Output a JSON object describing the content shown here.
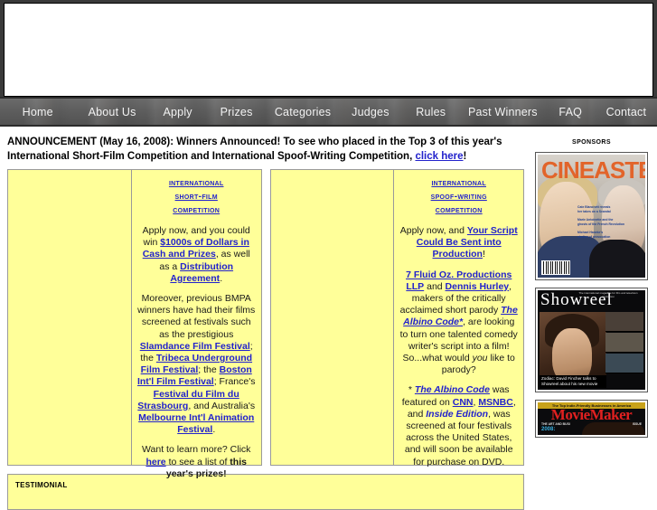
{
  "nav": {
    "items": [
      {
        "label": "Home"
      },
      {
        "label": "About Us"
      },
      {
        "label": "Apply"
      },
      {
        "label": "Prizes"
      },
      {
        "label": "Categories"
      },
      {
        "label": "Judges"
      },
      {
        "label": "Rules"
      },
      {
        "label": "Past Winners"
      },
      {
        "label": "FAQ"
      },
      {
        "label": "Contact"
      }
    ]
  },
  "announcement": {
    "line1": "ANNOUNCEMENT (May 16, 2008): Winners Announced! To see who placed in the Top 3 of this year's",
    "line2_pre": "International Short-Film Competition and International Spoof-Writing Competition, ",
    "link": "click here",
    "line2_post": "!"
  },
  "film_box": {
    "title_line1": "International",
    "title_line2": "Short-Film",
    "title_line3": "Competition",
    "p1_a": "Apply now, and you could win ",
    "p1_link1": "$1000s of Dollars in Cash and Prizes",
    "p1_b": ", as well as a ",
    "p1_link2": "Distribution Agreement",
    "p1_c": ".",
    "p2_a": "Moreover, previous BMPA winners have had their films screened at festivals such as the prestigious ",
    "p2_link1": "Slamdance Film Festival",
    "p2_b": "; the ",
    "p2_link2": "Tribeca Underground Film Festival",
    "p2_c": "; the ",
    "p2_link3": "Boston Int'l Film Festival",
    "p2_d": "; France's ",
    "p2_link4": "Festival du Film du Strasbourg",
    "p2_e": ", and Australia's ",
    "p2_link5": "Melbourne Int'l Animation Festival",
    "p2_f": ".",
    "p3_a": "Want to learn more? Click ",
    "p3_link": "here",
    "p3_b": " to see a list of ",
    "p3_bold": "this year's prizes!"
  },
  "spoof_box": {
    "title_line1": "International",
    "title_line2": "Spoof-Writing",
    "title_line3": "Competition",
    "p1_a": "Apply now, and ",
    "p1_link": "Your Script Could Be Sent into Production",
    "p1_b": "!",
    "p2_link1": "7 Fluid Oz. Productions LLP",
    "p2_a": " and ",
    "p2_link2": "Dennis Hurley",
    "p2_b": ", makers of the critically acclaimed short parody ",
    "p2_title": "The Albino Code*",
    "p2_c": ", are looking to turn one talented comedy writer's script into a film! So...what would ",
    "p2_you": "you",
    "p2_d": " like to parody?",
    "p3_star": "* ",
    "p3_title": "The Albino Code",
    "p3_a": " was featured on ",
    "p3_link1": "CNN",
    "p3_b": ", ",
    "p3_link2": "MSNBC",
    "p3_c": ", and ",
    "p3_em": "Inside Edition",
    "p3_d": ", was screened at four festivals across the United States, and will soon be available for purchase on DVD."
  },
  "testimonial": {
    "title": "Testimonial"
  },
  "sponsors": {
    "title": "Sponsors",
    "items": [
      {
        "name": "Cineaste",
        "wordmark": "CINEASTE",
        "blurbs": [
          "Cate Blanchett reveals",
          "her takes on a Scandal",
          "Marie Antoinette and the",
          "ghosts of the French Revolution",
          "Michael Haneke's",
          "studies of provocation"
        ]
      },
      {
        "name": "Showreel",
        "wordmark": "Showreel",
        "tagline": "The international magazine for film and television production",
        "caption": "Zodiac: David Fincher talks to Showreel about his new movie"
      },
      {
        "name": "MovieMaker",
        "wordmark": "MovieMaker",
        "topline": "The Top Indie-Friendly Businesses in America",
        "subleft": "THE ART AND BUSI",
        "subright": "ISSUE",
        "year": "2008:"
      }
    ]
  },
  "colors": {
    "panel_yellow": "#ffff99",
    "link_blue": "#2222cc",
    "nav_gray": "#6e6e6e",
    "border_gray": "#9a9a9a"
  }
}
